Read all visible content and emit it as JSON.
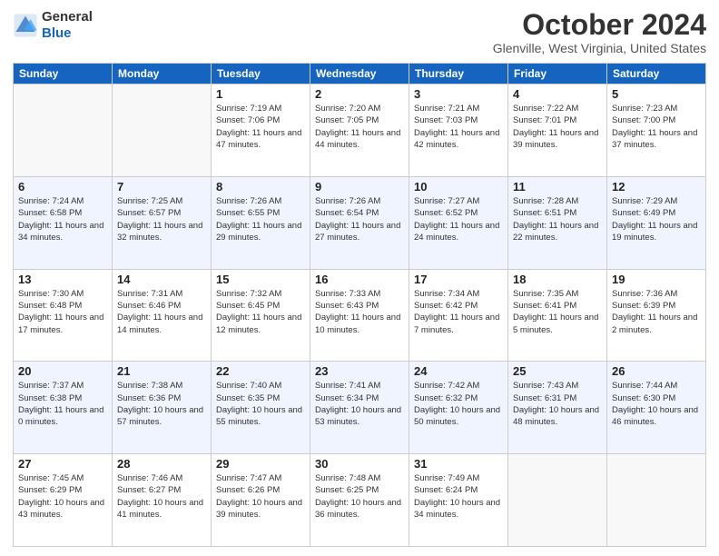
{
  "header": {
    "logo_line1": "General",
    "logo_line2": "Blue",
    "month": "October 2024",
    "location": "Glenville, West Virginia, United States"
  },
  "days_of_week": [
    "Sunday",
    "Monday",
    "Tuesday",
    "Wednesday",
    "Thursday",
    "Friday",
    "Saturday"
  ],
  "weeks": [
    [
      {
        "day": "",
        "info": ""
      },
      {
        "day": "",
        "info": ""
      },
      {
        "day": "1",
        "info": "Sunrise: 7:19 AM\nSunset: 7:06 PM\nDaylight: 11 hours and 47 minutes."
      },
      {
        "day": "2",
        "info": "Sunrise: 7:20 AM\nSunset: 7:05 PM\nDaylight: 11 hours and 44 minutes."
      },
      {
        "day": "3",
        "info": "Sunrise: 7:21 AM\nSunset: 7:03 PM\nDaylight: 11 hours and 42 minutes."
      },
      {
        "day": "4",
        "info": "Sunrise: 7:22 AM\nSunset: 7:01 PM\nDaylight: 11 hours and 39 minutes."
      },
      {
        "day": "5",
        "info": "Sunrise: 7:23 AM\nSunset: 7:00 PM\nDaylight: 11 hours and 37 minutes."
      }
    ],
    [
      {
        "day": "6",
        "info": "Sunrise: 7:24 AM\nSunset: 6:58 PM\nDaylight: 11 hours and 34 minutes."
      },
      {
        "day": "7",
        "info": "Sunrise: 7:25 AM\nSunset: 6:57 PM\nDaylight: 11 hours and 32 minutes."
      },
      {
        "day": "8",
        "info": "Sunrise: 7:26 AM\nSunset: 6:55 PM\nDaylight: 11 hours and 29 minutes."
      },
      {
        "day": "9",
        "info": "Sunrise: 7:26 AM\nSunset: 6:54 PM\nDaylight: 11 hours and 27 minutes."
      },
      {
        "day": "10",
        "info": "Sunrise: 7:27 AM\nSunset: 6:52 PM\nDaylight: 11 hours and 24 minutes."
      },
      {
        "day": "11",
        "info": "Sunrise: 7:28 AM\nSunset: 6:51 PM\nDaylight: 11 hours and 22 minutes."
      },
      {
        "day": "12",
        "info": "Sunrise: 7:29 AM\nSunset: 6:49 PM\nDaylight: 11 hours and 19 minutes."
      }
    ],
    [
      {
        "day": "13",
        "info": "Sunrise: 7:30 AM\nSunset: 6:48 PM\nDaylight: 11 hours and 17 minutes."
      },
      {
        "day": "14",
        "info": "Sunrise: 7:31 AM\nSunset: 6:46 PM\nDaylight: 11 hours and 14 minutes."
      },
      {
        "day": "15",
        "info": "Sunrise: 7:32 AM\nSunset: 6:45 PM\nDaylight: 11 hours and 12 minutes."
      },
      {
        "day": "16",
        "info": "Sunrise: 7:33 AM\nSunset: 6:43 PM\nDaylight: 11 hours and 10 minutes."
      },
      {
        "day": "17",
        "info": "Sunrise: 7:34 AM\nSunset: 6:42 PM\nDaylight: 11 hours and 7 minutes."
      },
      {
        "day": "18",
        "info": "Sunrise: 7:35 AM\nSunset: 6:41 PM\nDaylight: 11 hours and 5 minutes."
      },
      {
        "day": "19",
        "info": "Sunrise: 7:36 AM\nSunset: 6:39 PM\nDaylight: 11 hours and 2 minutes."
      }
    ],
    [
      {
        "day": "20",
        "info": "Sunrise: 7:37 AM\nSunset: 6:38 PM\nDaylight: 11 hours and 0 minutes."
      },
      {
        "day": "21",
        "info": "Sunrise: 7:38 AM\nSunset: 6:36 PM\nDaylight: 10 hours and 57 minutes."
      },
      {
        "day": "22",
        "info": "Sunrise: 7:40 AM\nSunset: 6:35 PM\nDaylight: 10 hours and 55 minutes."
      },
      {
        "day": "23",
        "info": "Sunrise: 7:41 AM\nSunset: 6:34 PM\nDaylight: 10 hours and 53 minutes."
      },
      {
        "day": "24",
        "info": "Sunrise: 7:42 AM\nSunset: 6:32 PM\nDaylight: 10 hours and 50 minutes."
      },
      {
        "day": "25",
        "info": "Sunrise: 7:43 AM\nSunset: 6:31 PM\nDaylight: 10 hours and 48 minutes."
      },
      {
        "day": "26",
        "info": "Sunrise: 7:44 AM\nSunset: 6:30 PM\nDaylight: 10 hours and 46 minutes."
      }
    ],
    [
      {
        "day": "27",
        "info": "Sunrise: 7:45 AM\nSunset: 6:29 PM\nDaylight: 10 hours and 43 minutes."
      },
      {
        "day": "28",
        "info": "Sunrise: 7:46 AM\nSunset: 6:27 PM\nDaylight: 10 hours and 41 minutes."
      },
      {
        "day": "29",
        "info": "Sunrise: 7:47 AM\nSunset: 6:26 PM\nDaylight: 10 hours and 39 minutes."
      },
      {
        "day": "30",
        "info": "Sunrise: 7:48 AM\nSunset: 6:25 PM\nDaylight: 10 hours and 36 minutes."
      },
      {
        "day": "31",
        "info": "Sunrise: 7:49 AM\nSunset: 6:24 PM\nDaylight: 10 hours and 34 minutes."
      },
      {
        "day": "",
        "info": ""
      },
      {
        "day": "",
        "info": ""
      }
    ]
  ]
}
